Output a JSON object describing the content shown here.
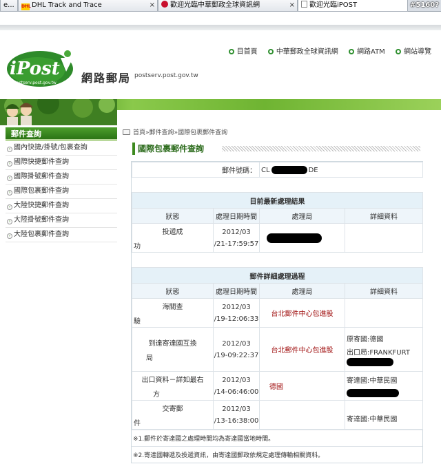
{
  "browser": {
    "tabs": [
      {
        "label": "e...",
        "active": false
      },
      {
        "label": "DHL Track and Trace",
        "active": false
      },
      {
        "label": "歡迎光臨中華郵政全球資訊網",
        "active": false
      },
      {
        "label": "歡迎光臨iPOST",
        "active": true
      }
    ],
    "tab_counter": "#5160?"
  },
  "header": {
    "logo_text": "iPost",
    "logo_small_url": "postserv.post.gov.tw",
    "site_name": "網路郵局",
    "site_url": "postserv.post.gov.tw",
    "nav": [
      "目首頁",
      "中華郵政全球資訊網",
      "網路ATM",
      "網站導覽"
    ]
  },
  "sidebar": {
    "title": "郵件查詢",
    "items": [
      {
        "label": "國內快捷/掛號/包裹查詢"
      },
      {
        "label": "國際快捷郵件查詢"
      },
      {
        "label": "國際掛號郵件查詢"
      },
      {
        "label": "國際包裹郵件查詢"
      },
      {
        "label": "大陸快捷郵件查詢"
      },
      {
        "label": "大陸掛號郵件查詢"
      },
      {
        "label": "大陸包裹郵件查詢"
      }
    ]
  },
  "breadcrumb": {
    "home": "首頁",
    "sep1": "»",
    "level1": "郵件查詢",
    "sep2": "»",
    "current": "國際包裹郵件查詢"
  },
  "page_title": "國際包裹郵件查詢",
  "tracking": {
    "label": "郵件號碼：",
    "prefix": "CL",
    "suffix": "DE"
  },
  "latest": {
    "title": "目前最新處理結果",
    "headers": [
      "狀態",
      "處理日期時間",
      "處理局",
      "詳細資料"
    ],
    "row": {
      "status_line1": "投遞成",
      "status_line2": "功",
      "date": "2012/03",
      "time": "/21-17:59:57",
      "office": "",
      "detail": ""
    }
  },
  "detail": {
    "title": "郵件詳細處理過程",
    "headers": [
      "狀態",
      "處理日期時間",
      "處理局",
      "詳細資料"
    ],
    "rows": [
      {
        "status_line1": "海關查",
        "status_line2": "驗",
        "date": "2012/03",
        "time": "/19-12:06:33",
        "office": "台北郵件中心包進股",
        "detail_line1": "",
        "detail_line2": ""
      },
      {
        "status_line1": "到達寄達國互換",
        "status_line2": "局",
        "date": "2012/03",
        "time": "/19-09:22:37",
        "office": "台北郵件中心包進股",
        "detail_line1": "原寄國:德國",
        "detail_line2": "出口局:FRANKFURT"
      },
      {
        "status_line1": "出口資料－詳如最右",
        "status_line2": "方",
        "date": "2012/03",
        "time": "/14-06:46:00",
        "office": "德國",
        "detail_line1": "寄達國:中華民國",
        "detail_line2": ""
      },
      {
        "status_line1": "交寄郵",
        "status_line2": "件",
        "date": "2012/03",
        "time": "/13-16:38:00",
        "office": "",
        "detail_line1": "寄達國:中華民國",
        "detail_line2": ""
      }
    ]
  },
  "notes": [
    "※1.郵件於寄達國之處理時間均為寄達國當地時間。",
    "※2.寄達國轉遞及投遞資訊，由寄達國郵政依規定處理傳輸相關資料。"
  ]
}
